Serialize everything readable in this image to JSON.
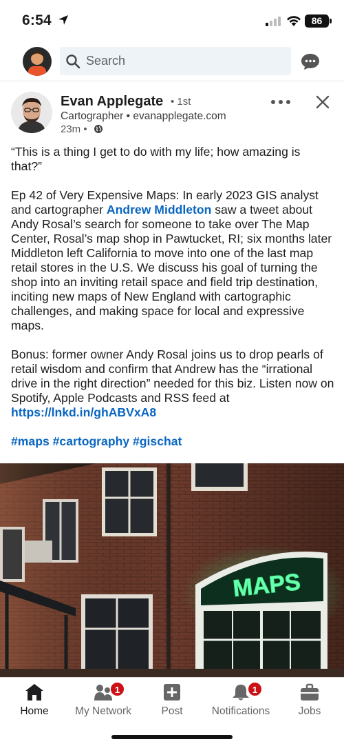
{
  "status_bar": {
    "time": "6:54",
    "battery": "86"
  },
  "search": {
    "placeholder": "Search"
  },
  "post": {
    "author": {
      "name": "Evan Applegate",
      "degree": "• 1st",
      "headline": "Cartographer • evanapplegate.com",
      "time": "23m •"
    },
    "body": {
      "quote": "“This is a thing I get to do with my life; how amazing is that?”",
      "p2_before": "Ep 42 of Very Expensive Maps: In early 2023 GIS analyst and cartographer ",
      "p2_mention": "Andrew Middleton",
      "p2_after": " saw a tweet about Andy Rosal’s search for someone to take over The Map Center, Rosal’s map shop in Pawtucket, RI; six months later Middleton left California to move into one of the last map retail stores in the U.S. We discuss his goal of turning the shop into an inviting retail space and field trip destination, inciting new maps of New England with cartographic challenges, and making space for local and expressive maps.",
      "p3_before": "Bonus: former owner Andy Rosal joins us to drop pearls of retail wisdom and confirm that Andrew has the “irrational drive in the right direction” needed for this biz. Listen now on Spotify, Apple Podcasts and RSS feed at ",
      "p3_link": "https://lnkd.in/ghABVxA8",
      "hashtags": "#maps #cartography #gischat"
    },
    "photo": {
      "sign_text": "MAPS"
    }
  },
  "tabbar": {
    "items": [
      {
        "label": "Home",
        "icon": "home-icon"
      },
      {
        "label": "My Network",
        "icon": "network-icon",
        "badge": "1"
      },
      {
        "label": "Post",
        "icon": "post-icon"
      },
      {
        "label": "Notifications",
        "icon": "bell-icon",
        "badge": "1"
      },
      {
        "label": "Jobs",
        "icon": "briefcase-icon"
      }
    ]
  },
  "colors": {
    "link": "#0a66c2",
    "badge": "#cc1016",
    "search_bg": "#eef3f8",
    "neon": "#3cf08a"
  }
}
